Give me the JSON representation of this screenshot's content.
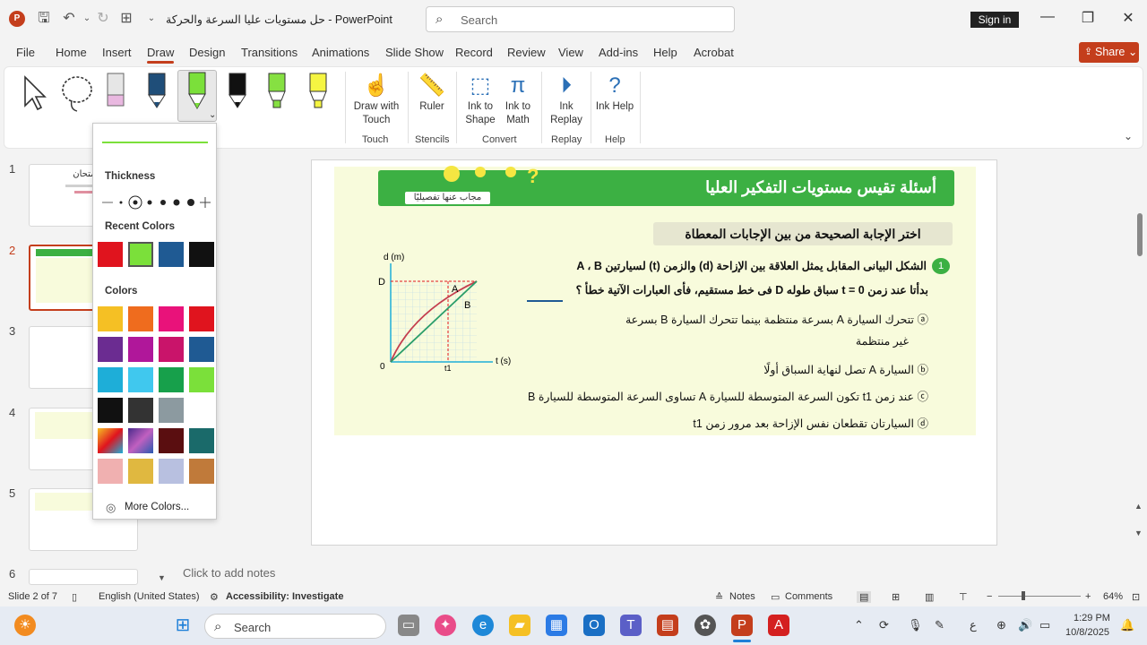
{
  "titlebar": {
    "doc_title": "حل مستويات عليا السرعة والحركة  -  PowerPoint",
    "search_placeholder": "Search",
    "signin": "Sign in"
  },
  "menu": {
    "tabs": [
      "File",
      "Home",
      "Insert",
      "Draw",
      "Design",
      "Transitions",
      "Animations",
      "Slide Show",
      "Record",
      "Review",
      "View",
      "Add-ins",
      "Help",
      "Acrobat"
    ],
    "active": "Draw",
    "share": "Share"
  },
  "ribbon": {
    "pens": [
      {
        "name": "select",
        "color": "#444444"
      },
      {
        "name": "lasso",
        "color": "#444444"
      },
      {
        "name": "eraser",
        "color": "#e9b8e0"
      },
      {
        "name": "pen-navy",
        "color": "#1f4e79"
      },
      {
        "name": "pen-green",
        "color": "#7be03a"
      },
      {
        "name": "pen-black",
        "color": "#111111"
      },
      {
        "name": "highlighter-green",
        "color": "#86e042"
      },
      {
        "name": "highlighter-yellow",
        "color": "#f5f542"
      }
    ],
    "buttons": {
      "draw_with_touch": "Draw with Touch",
      "ruler": "Ruler",
      "ink_to_shape": "Ink to Shape",
      "ink_to_math": "Ink to Math",
      "ink_replay": "Ink Replay",
      "ink_help": "Ink Help"
    },
    "groups": {
      "touch": "Touch",
      "stencils": "Stencils",
      "convert": "Convert",
      "replay": "Replay",
      "help": "Help"
    }
  },
  "dropdown": {
    "thickness_label": "Thickness",
    "recent_label": "Recent Colors",
    "colors_label": "Colors",
    "more_colors": "More Colors...",
    "recent": [
      "#e0141e",
      "#7be03a",
      "#1f5a93",
      "#111111"
    ],
    "colors": [
      "#f5c024",
      "#ef6c1e",
      "#e9127a",
      "#e0141e",
      "#6b2c91",
      "#b0179a",
      "#c9146a",
      "#1f5a93",
      "#1eaed8",
      "#40c8ee",
      "#17a04b",
      "#7be03a",
      "#111111",
      "#333333",
      "#8c9aa0",
      "#ffffff"
    ]
  },
  "thumbs": {
    "numbers": [
      "1",
      "2",
      "3",
      "4",
      "5",
      "6"
    ],
    "slide1_text": "سلسلة الامتحان"
  },
  "slide": {
    "banner_title": "أسئلة تقيس مستويات التفكير العليا",
    "banner_tag": "مجاب عنها تفصيليًا",
    "header": "اختر الإجابة الصحيحة من بين الإجابات المعطاة",
    "q_number": "1",
    "question_line1": "الشكل البيانى المقابل يمثل العلاقة بين الإزاحة (d) والزمن (t) لسيارتين A ، B",
    "question_line2": "بدأتا عند زمن t = 0 سباق طوله D فى خط مستقيم، فأى العبارات الآتية خطأ ؟",
    "options": [
      "ⓐ تتحرك السيارة A بسرعة منتظمة بينما تتحرك السيارة B بسرعة",
      "غير منتظمة",
      "ⓑ السيارة A تصل لنهاية السباق أولًا",
      "ⓒ عند زمن t1 تكون السرعة المتوسطة للسيارة A تساوى السرعة المتوسطة للسيارة B",
      "ⓓ السيارتان تقطعان نفس الإزاحة بعد مرور زمن t1"
    ],
    "graph": {
      "y_axis": "d (m)",
      "x_axis": "t (s)",
      "origin": "0",
      "D": "D",
      "t1": "t1",
      "A": "A",
      "B": "B"
    }
  },
  "notes": {
    "placeholder": "Click to add notes"
  },
  "status": {
    "slide": "Slide 2 of 7",
    "language": "English (United States)",
    "accessibility": "Accessibility: Investigate",
    "notes": "Notes",
    "comments": "Comments",
    "zoom": "64%"
  },
  "taskbar": {
    "search": "Search",
    "time": "1:29 PM",
    "date": "10/8/2025",
    "lang": "ع"
  }
}
